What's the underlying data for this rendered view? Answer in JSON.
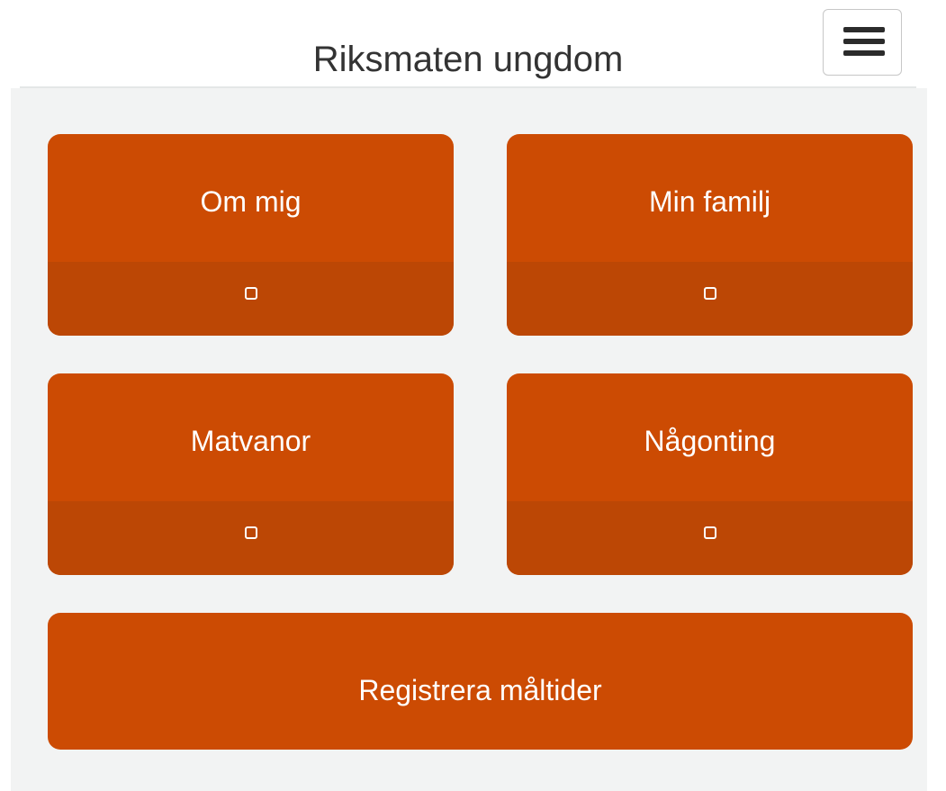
{
  "header": {
    "title": "Riksmaten ungdom",
    "menu_icon": "hamburger-menu-icon"
  },
  "tiles": [
    {
      "label": "Om mig",
      "status_icon": "checkbox-icon",
      "checked": false
    },
    {
      "label": "Min familj",
      "status_icon": "checkbox-icon",
      "checked": false
    },
    {
      "label": "Matvanor",
      "status_icon": "checkbox-icon",
      "checked": false
    },
    {
      "label": "Någonting",
      "status_icon": "checkbox-icon",
      "checked": false
    }
  ],
  "register_button": {
    "label": "Registrera måltider"
  },
  "colors": {
    "accent": "#cc4b03",
    "accent_dark": "#bc4705",
    "background": "#f2f3f3"
  }
}
